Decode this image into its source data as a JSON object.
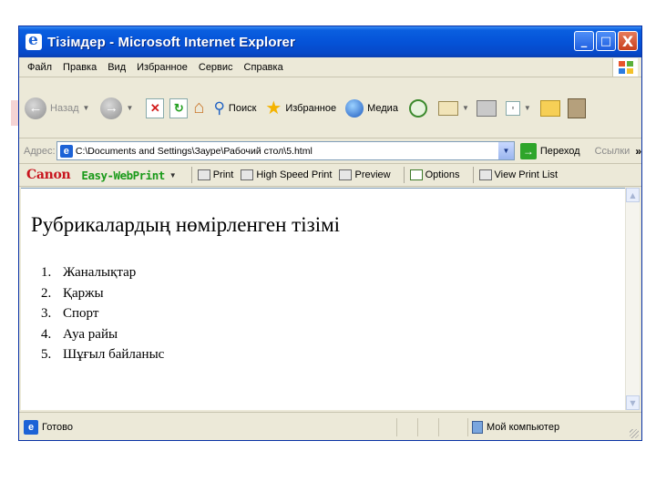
{
  "window": {
    "title": "Тізімдер - Microsoft Internet Explorer",
    "controls": {
      "minimize": "_",
      "maximize": "□",
      "close": "X"
    }
  },
  "menu": {
    "items": [
      "Файл",
      "Правка",
      "Вид",
      "Избранное",
      "Сервис",
      "Справка"
    ]
  },
  "toolbar": {
    "back_label": "Назад",
    "search_label": "Поиск",
    "favorites_label": "Избранное",
    "media_label": "Медиа"
  },
  "address": {
    "label": "Адрес:",
    "value": "C:\\Documents and Settings\\Зауре\\Рабочий стол\\5.html",
    "go_label": "Переход",
    "links_label": "Ссылки"
  },
  "canon_bar": {
    "logo": "Canon",
    "product": "Easy-WebPrint",
    "buttons": [
      "Print",
      "High Speed Print",
      "Preview",
      "Options",
      "View Print List"
    ]
  },
  "content": {
    "heading": "Рубрикалардың нөмірленген тізімі",
    "list_items": [
      {
        "num": "1.",
        "text": "Жаналықтар"
      },
      {
        "num": "2.",
        "text": "Қаржы"
      },
      {
        "num": "3.",
        "text": "Спорт"
      },
      {
        "num": "4.",
        "text": "Ауа райы"
      },
      {
        "num": "5.",
        "text": "Шұғыл байланыс"
      }
    ]
  },
  "status": {
    "text": "Готово",
    "zone": "Мой компьютер"
  },
  "colors": {
    "titlebar": "#0553d8",
    "window_bg": "#ece9d8",
    "canon_red": "#c8141e",
    "ewp_green": "#1a9a1a"
  }
}
